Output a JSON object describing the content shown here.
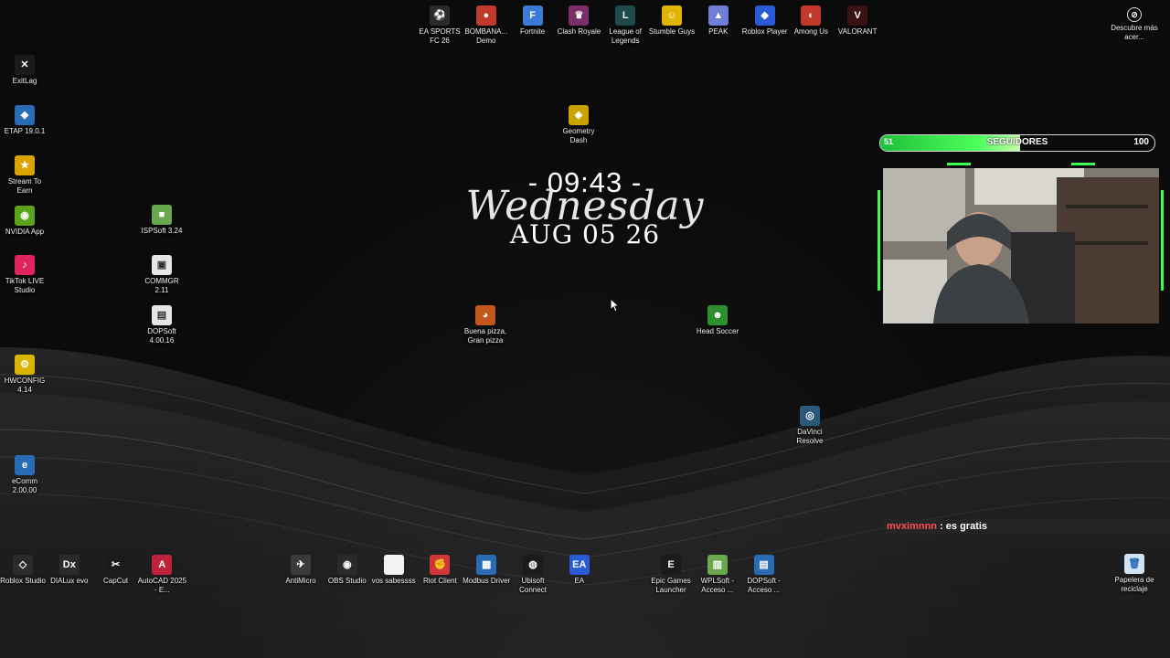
{
  "desktop": {
    "top_icons": [
      {
        "label": "EA SPORTS FC 26",
        "icon": "ea-sports-fc-icon",
        "color": "#2b2b2b",
        "glyph": "⚽"
      },
      {
        "label": "BOMBANA... Demo",
        "icon": "bombana-icon",
        "color": "#c0392b",
        "glyph": "●"
      },
      {
        "label": "Fortnite",
        "icon": "fortnite-icon",
        "color": "#3b7bd8",
        "glyph": "F"
      },
      {
        "label": "Clash Royale",
        "icon": "clash-royale-icon",
        "color": "#7a2f6b",
        "glyph": "♛"
      },
      {
        "label": "League of Legends",
        "icon": "league-of-legends-icon",
        "color": "#1d4b4b",
        "glyph": "L"
      },
      {
        "label": "Stumble Guys",
        "icon": "stumble-guys-icon",
        "color": "#e0b400",
        "glyph": "☺"
      },
      {
        "label": "PEAK",
        "icon": "peak-icon",
        "color": "#6f7fd6",
        "glyph": "▲"
      },
      {
        "label": "Roblox Player",
        "icon": "roblox-player-icon",
        "color": "#2a5bd7",
        "glyph": "◆"
      },
      {
        "label": "Among Us",
        "icon": "among-us-icon",
        "color": "#c0392b",
        "glyph": "◐"
      },
      {
        "label": "VALORANT",
        "icon": "valorant-icon",
        "color": "#3a1216",
        "glyph": "V"
      }
    ],
    "discover_widget": {
      "label": "Descubre más acer...",
      "icon": "discover-icon"
    },
    "left_column_icons": [
      {
        "label": "ExitLag",
        "icon": "exitlag-icon",
        "color": "#1b1b1b",
        "glyph": "✕"
      },
      {
        "label": "ETAP 19.0.1",
        "icon": "etap-icon",
        "color": "#2a6bb5",
        "glyph": "◆"
      },
      {
        "label": "Stream To Earn",
        "icon": "stream-to-earn-icon",
        "color": "#d9a400",
        "glyph": "★"
      },
      {
        "label": "NVIDIA App",
        "icon": "nvidia-icon",
        "color": "#5aa31b",
        "glyph": "◉"
      },
      {
        "label": "TikTok LIVE Studio",
        "icon": "tiktok-live-icon",
        "color": "#e0245e",
        "glyph": "♪"
      },
      {
        "label": "HWCONFIG 4.14",
        "icon": "hwconfig-icon",
        "color": "#d9b400",
        "glyph": "⚙"
      },
      {
        "label": "eComm 2.00.00",
        "icon": "ecomm-icon",
        "color": "#2a6bb5",
        "glyph": "e"
      }
    ],
    "second_column_icons": [
      {
        "label": "ISPSoft 3.24",
        "icon": "ispsoft-icon",
        "color": "#6aa84f",
        "glyph": "■"
      },
      {
        "label": "COMMGR 2.11",
        "icon": "commgr-icon",
        "color": "#e6e6e6",
        "glyph": "▣"
      },
      {
        "label": "DOPSoft 4.00.16",
        "icon": "dopsoft-icon",
        "color": "#e6e6e6",
        "glyph": "▤"
      }
    ],
    "scattered_icons": [
      {
        "label": "Geometry Dash",
        "icon": "geometry-dash-icon",
        "color": "#c9a400",
        "glyph": "◈"
      },
      {
        "label": "Buena pizza, Gran pizza",
        "icon": "pizza-icon",
        "color": "#c2561b",
        "glyph": "◕"
      },
      {
        "label": "Head Soccer",
        "icon": "head-soccer-icon",
        "color": "#2d8f2d",
        "glyph": "☻"
      },
      {
        "label": "DaVinci Resolve",
        "icon": "davinci-resolve-icon",
        "color": "#2a5a7a",
        "glyph": "◎"
      }
    ],
    "bottom_left_icons": [
      {
        "label": "Roblox Studio",
        "icon": "roblox-studio-icon",
        "color": "#2b2b2b",
        "glyph": "◇"
      },
      {
        "label": "DIALux evo",
        "icon": "dialux-icon",
        "color": "#2b2b2b",
        "glyph": "Dx"
      },
      {
        "label": "CapCut",
        "icon": "capcut-icon",
        "color": "#1b1b1b",
        "glyph": "✂"
      },
      {
        "label": "AutoCAD 2025 - E...",
        "icon": "autocad-icon",
        "color": "#c0223b",
        "glyph": "A"
      }
    ],
    "bottom_middle_icons": [
      {
        "label": "AntiMicro",
        "icon": "antimicro-icon",
        "color": "#3a3a3a",
        "glyph": "✈"
      },
      {
        "label": "OBS Studio",
        "icon": "obs-studio-icon",
        "color": "#2b2b2b",
        "glyph": "◉"
      },
      {
        "label": "vos sabessss",
        "icon": "text-file-icon",
        "color": "#f2f2f2",
        "glyph": ""
      },
      {
        "label": "Riot Client",
        "icon": "riot-client-icon",
        "color": "#d13639",
        "glyph": "✊"
      },
      {
        "label": "Modbus Driver",
        "icon": "modbus-driver-icon",
        "color": "#2a6bb5",
        "glyph": "▦"
      },
      {
        "label": "Ubisoft Connect",
        "icon": "ubisoft-connect-icon",
        "color": "#1b1b1b",
        "glyph": "◍"
      },
      {
        "label": "EA",
        "icon": "ea-icon",
        "color": "#2a5bd7",
        "glyph": "EA"
      }
    ],
    "bottom_right_icons": [
      {
        "label": "Epic Games Launcher",
        "icon": "epic-games-icon",
        "color": "#1b1b1b",
        "glyph": "E"
      },
      {
        "label": "WPLSoft - Acceso ...",
        "icon": "wplsoft-icon",
        "color": "#6aa84f",
        "glyph": "▥"
      },
      {
        "label": "DOPSoft - Acceso ...",
        "icon": "dopsoft-shortcut-icon",
        "color": "#2a6bb5",
        "glyph": "▤"
      }
    ],
    "recycle_bin": {
      "label": "Papelera de reciclaje",
      "icon": "recycle-bin-icon"
    }
  },
  "clock": {
    "time": "- 09:43 -",
    "day": "Wednesday",
    "date": "AUG 05 26"
  },
  "followers": {
    "current": "51",
    "label": "SEGUIDORES",
    "goal": "100",
    "progress_fraction": 0.51
  },
  "chat": {
    "user": "mvximnnn",
    "message": ": es gratis"
  },
  "colors": {
    "accent_green": "#3cff4a",
    "chat_user": "#ff4d4d"
  }
}
